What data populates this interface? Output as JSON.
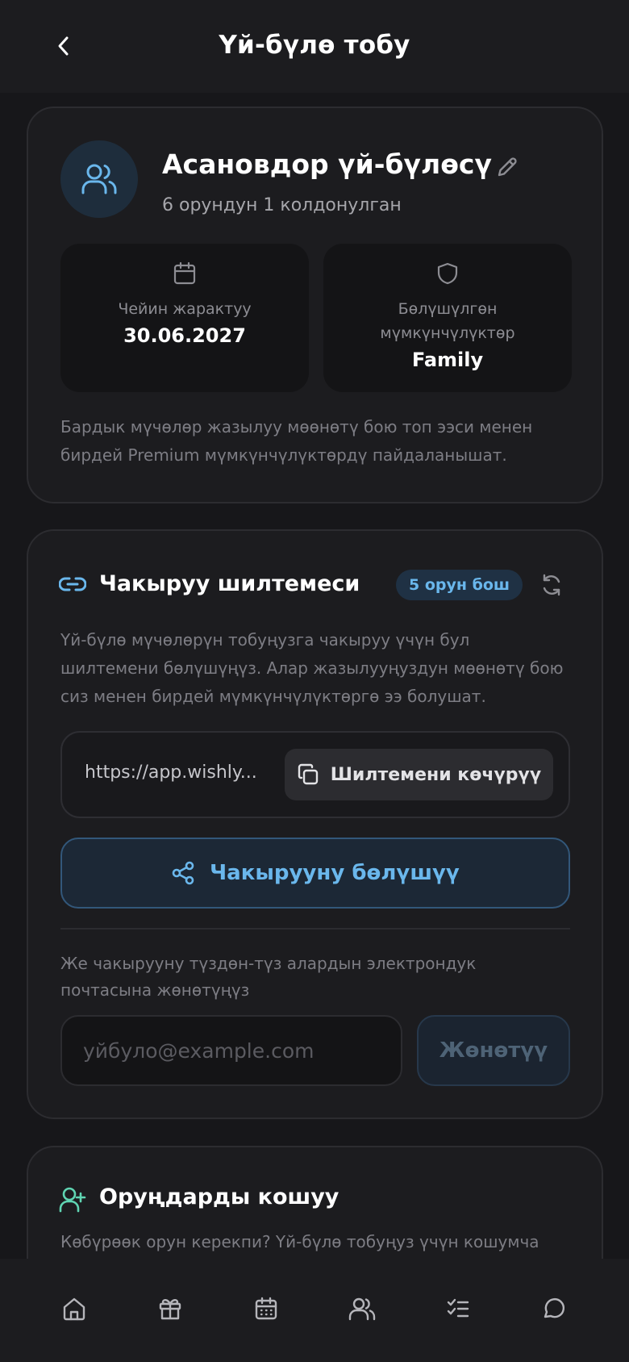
{
  "header": {
    "title": "Үй-бүлө тобу"
  },
  "group": {
    "name": "Асановдор үй-бүлөсү",
    "seats_used": "6 орундун 1 колдонулган",
    "stats": [
      {
        "label": "Чейин жарактуу",
        "value": "30.06.2027",
        "icon": "calendar-icon"
      },
      {
        "label": "Бөлүшүлгөн мүмкүнчүлүктөр",
        "value": "Family",
        "icon": "shield-icon"
      }
    ],
    "note": "Бардык мүчөлөр жазылуу мөөнөтү бою топ ээси менен бирдей Premium мүмкүнчүлүктөрдү пайдаланышат."
  },
  "invite": {
    "title": "Чакыруу шилтемеси",
    "badge": "5 орун бош",
    "description": "Үй-бүлө мүчөлөрүн тобуңузга чакыруу үчүн бул шилтемени бөлүшүңүз. Алар жазылууңуздун мөөнөтү бою сиз менен бирдей мүмкүнчүлүктөргө ээ болушат.",
    "link": "https://app.wishly...",
    "copy_label": "Шилтемени көчүрүү",
    "share_label": "Чакырууну бөлүшүү",
    "email_note": "Же чакырууну түздөн-түз алардын электрондук почтасына жөнөтүңүз",
    "email_placeholder": "уйбуло@example.com",
    "send_label": "Жөнөтүү"
  },
  "add_seats": {
    "title": "Оруңдарды кошуу",
    "description": "Көбүрөөк орун керекпи? Үй-бүлө тобуңуз үчүн кошумча"
  },
  "nav": [
    "home-icon",
    "gift-icon",
    "calendar-icon",
    "users-icon",
    "checklist-icon",
    "chat-icon"
  ],
  "colors": {
    "accent": "#6ab7ec",
    "add_accent": "#5fd4b2",
    "background": "#17171a",
    "card": "#1c1c1f"
  }
}
